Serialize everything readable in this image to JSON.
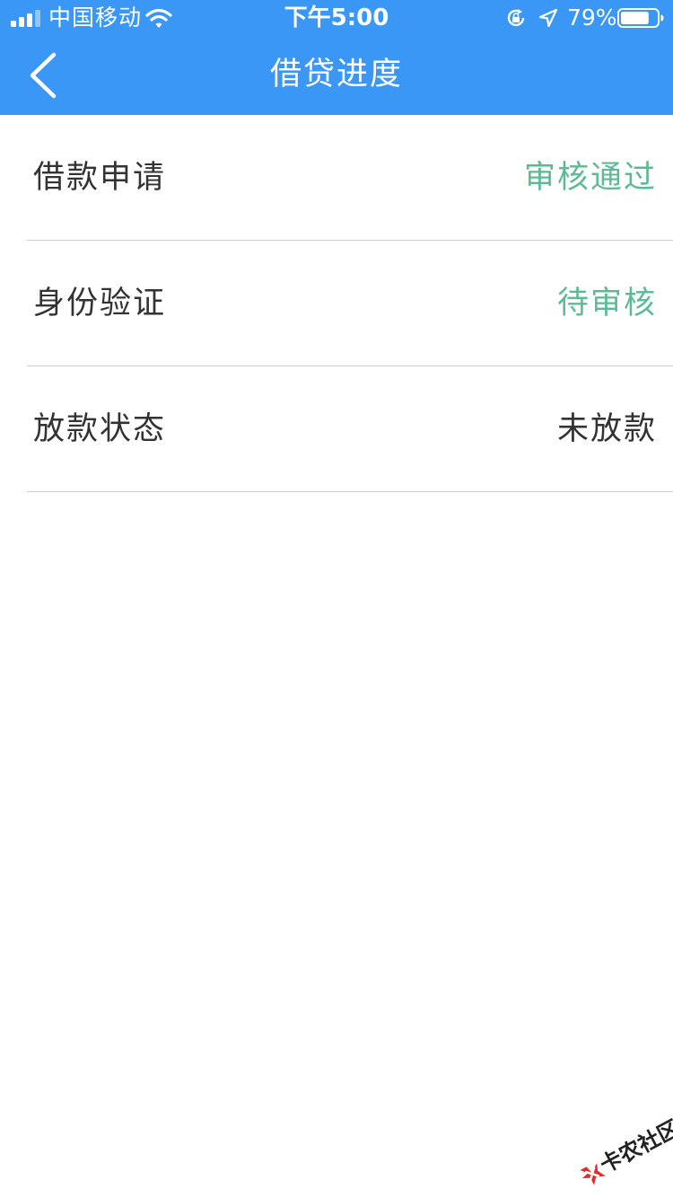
{
  "status_bar": {
    "carrier": "中国移动",
    "time": "下午5:00",
    "battery_percent": "79%",
    "battery_level": 0.79,
    "icons": [
      "signal-icon",
      "wifi-icon",
      "lock-rotation-icon",
      "location-icon",
      "battery-icon"
    ]
  },
  "nav": {
    "title": "借贷进度",
    "back_icon": "chevron-left-icon"
  },
  "rows": [
    {
      "label": "借款申请",
      "value": "审核通过"
    },
    {
      "label": "身份验证",
      "value": "待审核"
    },
    {
      "label": "放款状态",
      "value": "未放款"
    }
  ],
  "watermark": {
    "text": "卡农社区"
  },
  "colors": {
    "header_bg": "#3a97f5",
    "status_green": "#5dbb93",
    "text_dark": "#333333",
    "divider": "#cfcfcf"
  }
}
